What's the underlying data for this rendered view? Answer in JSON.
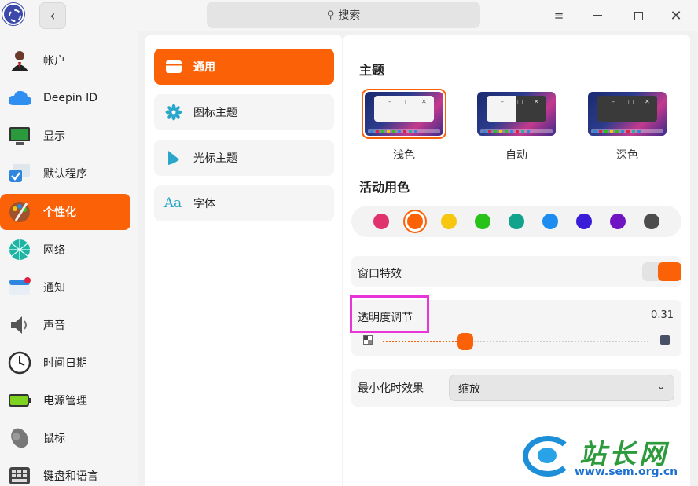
{
  "titlebar": {
    "search_placeholder": "搜索",
    "back_icon": "‹",
    "search_icon": "⚲",
    "menu_icon": "≡",
    "close_icon": "✕"
  },
  "sidebar": {
    "items": [
      {
        "label": "帐户",
        "icon": "user-avatar-icon"
      },
      {
        "label": "Deepin ID",
        "icon": "cloud-icon"
      },
      {
        "label": "显示",
        "icon": "monitor-icon"
      },
      {
        "label": "默认程序",
        "icon": "default-apps-icon"
      },
      {
        "label": "个性化",
        "icon": "palette-icon",
        "active": true
      },
      {
        "label": "网络",
        "icon": "network-globe-icon"
      },
      {
        "label": "通知",
        "icon": "notification-icon"
      },
      {
        "label": "声音",
        "icon": "speaker-icon"
      },
      {
        "label": "时间日期",
        "icon": "clock-icon"
      },
      {
        "label": "电源管理",
        "icon": "battery-icon"
      },
      {
        "label": "鼠标",
        "icon": "mouse-icon"
      },
      {
        "label": "键盘和语言",
        "icon": "keyboard-icon"
      }
    ]
  },
  "submenu": {
    "items": [
      {
        "label": "通用",
        "icon": "window-icon",
        "active": true
      },
      {
        "label": "图标主题",
        "icon": "flower-icon"
      },
      {
        "label": "光标主题",
        "icon": "cursor-icon"
      },
      {
        "label": "字体",
        "icon": "font-icon",
        "glyph": "Aa"
      }
    ]
  },
  "theme": {
    "title": "主题",
    "options": [
      {
        "label": "浅色",
        "variant": "light",
        "selected": true
      },
      {
        "label": "自动",
        "variant": "auto"
      },
      {
        "label": "深色",
        "variant": "dark"
      }
    ],
    "window_controls": [
      "–",
      "□",
      "✕"
    ]
  },
  "accent": {
    "title": "活动用色",
    "colors": [
      "#e0336e",
      "#fb6207",
      "#f6c70e",
      "#28c21b",
      "#12a38c",
      "#1c8cf0",
      "#3a1dd6",
      "#6e14c3",
      "#4d4d4d"
    ],
    "selected_index": 1
  },
  "effects": {
    "label": "窗口特效",
    "enabled": true
  },
  "opacity": {
    "label": "透明度调节",
    "value": "0.31",
    "fraction": 0.31
  },
  "minimize": {
    "label": "最小化时效果",
    "selected": "缩放",
    "chevron": "⌄"
  },
  "watermark": {
    "title": "站长网",
    "url": "www.sem.org.cn"
  }
}
